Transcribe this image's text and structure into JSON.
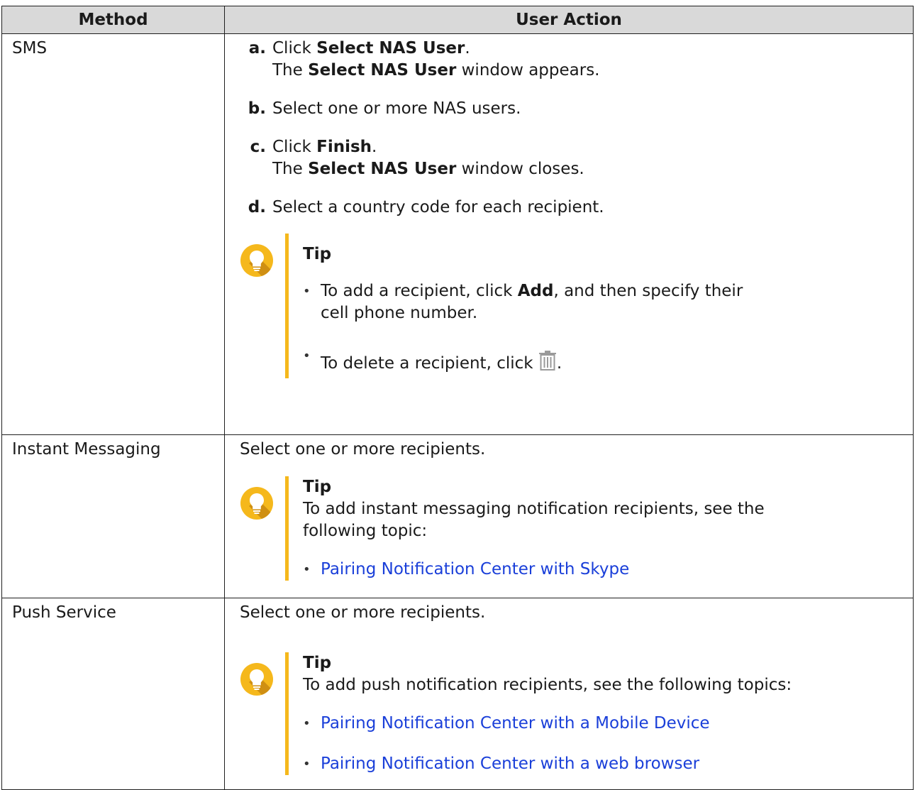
{
  "table": {
    "headers": {
      "method": "Method",
      "user_action": "User Action"
    },
    "sms": {
      "method": "SMS",
      "step_a": {
        "letter": "a.",
        "click": "Click",
        "select_nas_user": "Select NAS User",
        "period": ".",
        "the": "The",
        "window_appears": "window appears."
      },
      "step_b": {
        "letter": "b.",
        "text": "Select one or more NAS users."
      },
      "step_c": {
        "letter": "c.",
        "click": "Click",
        "finish": "Finish",
        "period": ".",
        "the": "The",
        "select_nas_user": "Select NAS User",
        "window_closes": "window closes."
      },
      "step_d": {
        "letter": "d.",
        "text": "Select a country code for each recipient."
      },
      "tip": {
        "title": "Tip",
        "bullet_add_pre": "To add a recipient, click",
        "bullet_add_bold": "Add",
        "bullet_add_post": ", and then specify their cell phone number.",
        "bullet_delete_pre": "To delete a recipient, click",
        "bullet_delete_post": "."
      }
    },
    "instant_messaging": {
      "method": "Instant Messaging",
      "action": "Select one or more recipients.",
      "tip": {
        "title": "Tip",
        "text": "To add instant messaging notification recipients, see the following topic:",
        "links": [
          "Pairing Notification Center with Skype"
        ]
      }
    },
    "push_service": {
      "method": "Push Service",
      "action": "Select one or more recipients.",
      "tip": {
        "title": "Tip",
        "text": "To add push notification recipients, see the following topics:",
        "links": [
          "Pairing Notification Center with a Mobile Device",
          "Pairing Notification Center with a web browser"
        ]
      }
    }
  },
  "icons": {
    "tip": "lightbulb-icon",
    "delete": "trash-icon"
  },
  "colors": {
    "header_bg": "#d9d9d9",
    "tip_accent": "#f5b81c",
    "link": "#1a3fd9"
  }
}
